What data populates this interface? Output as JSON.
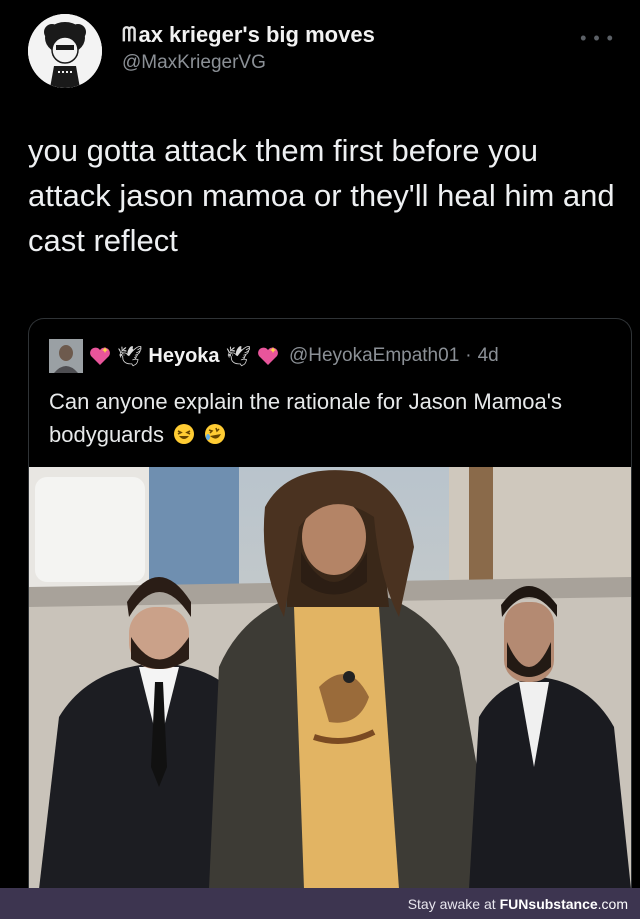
{
  "tweet": {
    "logo_mark": "ᗰ",
    "display_name": "ax krieger's big moves",
    "handle": "@MaxKriegerVG",
    "more_icon": "more-dots",
    "text": "you gotta attack them first before you attack jason mamoa or they'll heal him and cast reflect"
  },
  "quote": {
    "display_name": "Heyoka",
    "handle": "@HeyokaEmpath01",
    "separator": "·",
    "time": "4d",
    "text": "Can anyone explain the rationale for Jason Mamoa's bodyguards",
    "emojis": [
      "laughing-face",
      "rolling-laughing-face"
    ]
  },
  "footer": {
    "tagline": "Stay awake at",
    "brand_a": "FUN",
    "brand_b": "substance",
    "brand_c": ".com"
  },
  "colors": {
    "background": "#000000",
    "text": "#e7e9ea",
    "muted": "#8b9096",
    "footer_bg": "#3d3550"
  }
}
